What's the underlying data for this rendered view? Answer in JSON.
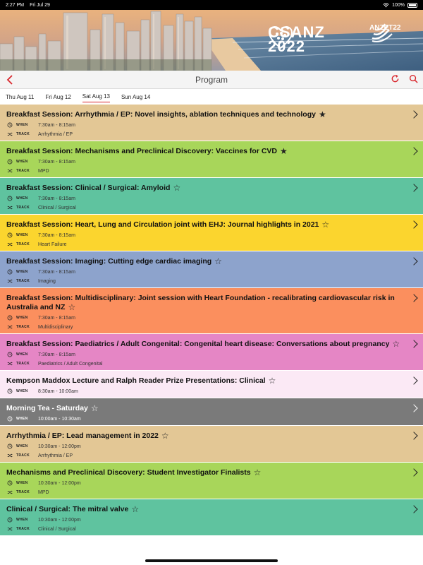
{
  "status_bar": {
    "time": "2:27 PM",
    "date": "Fri Jul 29",
    "battery": "100%"
  },
  "banner": {
    "logo_line1": "CSANZ",
    "logo_line2": "2022",
    "partner_logo": "ANZET22"
  },
  "nav": {
    "title": "Program",
    "back_icon": "chevron-left-icon",
    "refresh_icon": "refresh-icon",
    "search_icon": "search-icon"
  },
  "days": [
    {
      "label": "Thu Aug 11",
      "active": false
    },
    {
      "label": "Fri Aug 12",
      "active": false
    },
    {
      "label": "Sat Aug 13",
      "active": true
    },
    {
      "label": "Sun Aug 14",
      "active": false
    }
  ],
  "labels": {
    "when": "WHEN",
    "track": "TRACK"
  },
  "sessions": [
    {
      "title": "Breakfast Session: Arrhythmia / EP: Novel insights, ablation techniques and technology",
      "starred": true,
      "when": "7:30am - 8:15am",
      "track": "Arrhythmia / EP",
      "color": "#e3c795"
    },
    {
      "title": "Breakfast Session: Mechanisms and Preclinical Discovery: Vaccines for CVD",
      "starred": true,
      "when": "7:30am - 8:15am",
      "track": "MPD",
      "color": "#a8d65a"
    },
    {
      "title": "Breakfast Session: Clinical / Surgical: Amyloid",
      "starred": false,
      "when": "7:30am - 8:15am",
      "track": "Clinical / Surgical",
      "color": "#5fc39f"
    },
    {
      "title": "Breakfast Session: Heart, Lung and Circulation joint with EHJ: Journal highlights in 2021",
      "starred": false,
      "when": "7:30am - 8:15am",
      "track": "Heart Failure",
      "color": "#fbd52e"
    },
    {
      "title": "Breakfast Session: Imaging: Cutting edge cardiac imaging",
      "starred": false,
      "when": "7:30am - 8:15am",
      "track": "Imaging",
      "color": "#8da3cc"
    },
    {
      "title": "Breakfast Session: Multidisciplinary: Joint session with Heart Foundation - recalibrating cardiovascular risk in Australia and NZ",
      "starred": false,
      "when": "7:30am - 8:15am",
      "track": "Multidisciplinary",
      "color": "#fb8f5e"
    },
    {
      "title": "Breakfast Session: Paediatrics / Adult Congenital: Congenital heart disease: Conversations about pregnancy",
      "starred": false,
      "when": "7:30am - 8:15am",
      "track": "Paediatrics / Adult Congenital",
      "color": "#e586c5"
    },
    {
      "title": "Kempson Maddox Lecture and Ralph Reader Prize Presentations: Clinical",
      "starred": false,
      "when": "8:30am - 10:00am",
      "track": "",
      "color": "#fbe9f5"
    },
    {
      "title": "Morning Tea - Saturday",
      "starred": false,
      "when": "10:00am - 10:30am",
      "track": "",
      "color": "#7a7a7a",
      "dark": true
    },
    {
      "title": "Arrhythmia / EP: Lead management in 2022",
      "starred": false,
      "when": "10:30am - 12:00pm",
      "track": "Arrhythmia / EP",
      "color": "#e3c795"
    },
    {
      "title": "Mechanisms and Preclinical Discovery: Student Investigator Finalists",
      "starred": false,
      "when": "10:30am - 12:00pm",
      "track": "MPD",
      "color": "#a8d65a"
    },
    {
      "title": "Clinical / Surgical: The mitral valve",
      "starred": false,
      "when": "10:30am - 12:00pm",
      "track": "Clinical / Surgical",
      "color": "#5fc39f"
    }
  ]
}
